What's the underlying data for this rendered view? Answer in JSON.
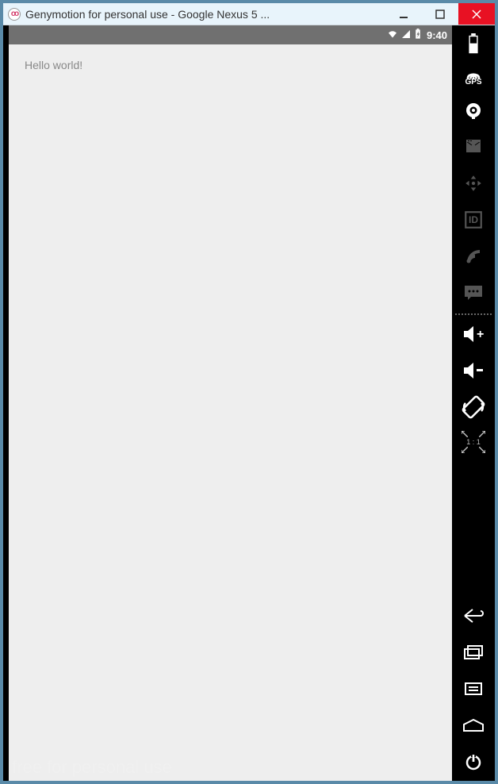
{
  "window": {
    "title": "Genymotion for personal use - Google Nexus 5 ..."
  },
  "statusbar": {
    "time": "9:40"
  },
  "app": {
    "content": "Hello world!",
    "watermark": "free for personal use"
  },
  "toolbar": {
    "gps_label": "GPS",
    "id_label": "ID",
    "scale_ratio": "1 : 1"
  }
}
